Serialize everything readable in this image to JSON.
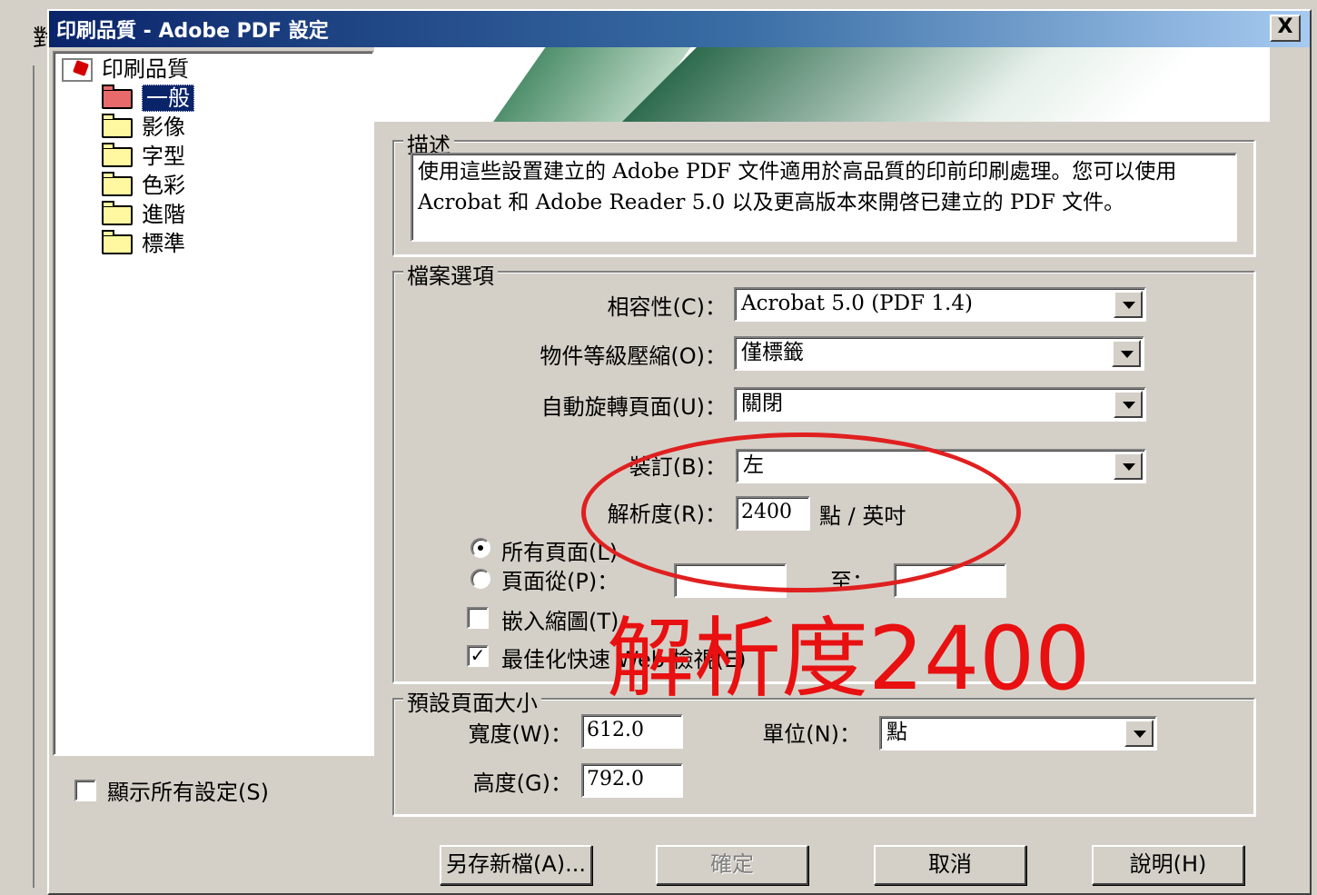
{
  "background": {
    "glyph": "對"
  },
  "dialog": {
    "title": "印刷品質 - Adobe PDF 設定",
    "close_label": "X"
  },
  "tree": {
    "root": "印刷品質",
    "items": [
      {
        "label": "一般",
        "selected": true,
        "icon": "folder-open-icon"
      },
      {
        "label": "影像",
        "icon": "folder-icon"
      },
      {
        "label": "字型",
        "icon": "folder-icon"
      },
      {
        "label": "色彩",
        "icon": "folder-icon"
      },
      {
        "label": "進階",
        "icon": "folder-icon"
      },
      {
        "label": "標準",
        "icon": "folder-icon"
      }
    ]
  },
  "show_all": {
    "label": "顯示所有設定(S)",
    "checked": false
  },
  "description": {
    "title": "描述",
    "text": "使用這些設置建立的 Adobe PDF 文件適用於高品質的印前印刷處理。您可以使用 Acrobat 和 Adobe Reader 5.0 以及更高版本來開啓已建立的 PDF 文件。"
  },
  "file_options": {
    "title": "檔案選項",
    "compat_label": "相容性(C)：",
    "compat_value": "Acrobat 5.0 (PDF 1.4)",
    "compress_label": "物件等級壓縮(O)：",
    "compress_value": "僅標籤",
    "rotate_label": "自動旋轉頁面(U)：",
    "rotate_value": "關閉",
    "binding_label": "裝訂(B)：",
    "binding_value": "左",
    "resolution_label": "解析度(R)：",
    "resolution_value": "2400",
    "resolution_unit": "點 / 英吋",
    "all_pages_label": "所有頁面(L)",
    "page_range_label": "頁面從(P)：",
    "to_label": "至：",
    "page_from_value": "",
    "page_to_value": "",
    "embed_thumbs_label": "嵌入縮圖(T)",
    "fast_web_label": "最佳化快速 Web 檢視(E)"
  },
  "page_size": {
    "title": "預設頁面大小",
    "width_label": "寬度(W)：",
    "width_value": "612.0",
    "height_label": "高度(G)：",
    "height_value": "792.0",
    "unit_label": "單位(N)：",
    "unit_value": "點"
  },
  "buttons": {
    "save_as": "另存新檔(A)...",
    "ok": "確定",
    "cancel": "取消",
    "help": "說明(H)"
  },
  "annotation": {
    "text": "解析度2400",
    "color": "#e81010"
  }
}
